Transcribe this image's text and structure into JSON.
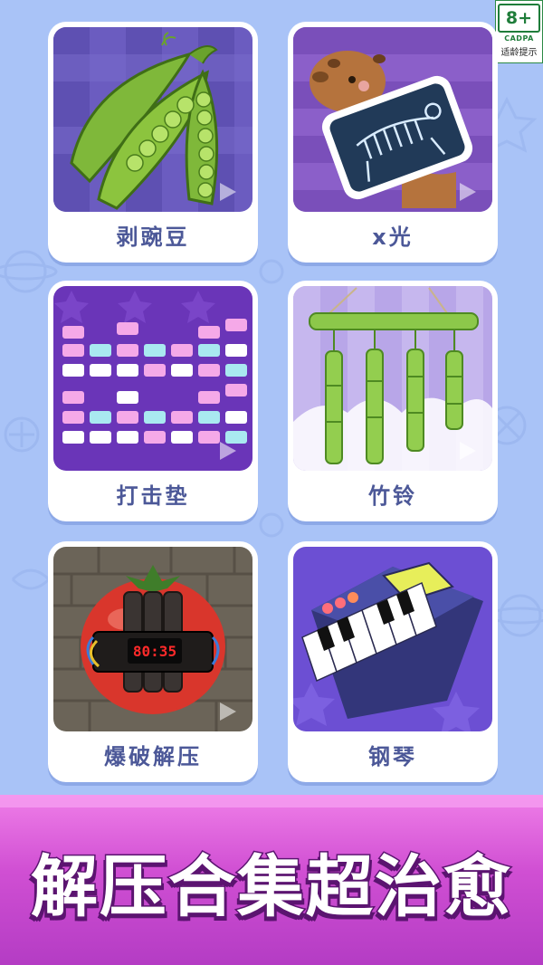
{
  "age_rating": {
    "value": "8+",
    "organization": "CADPA",
    "caption": "适龄提示"
  },
  "games": [
    {
      "label": "剥豌豆",
      "thumbnail_icon": "pea-pods-icon"
    },
    {
      "label": "x光",
      "thumbnail_icon": "capybara-xray-icon"
    },
    {
      "label": "打击垫",
      "thumbnail_icon": "drum-pad-icon"
    },
    {
      "label": "竹铃",
      "thumbnail_icon": "bamboo-chime-icon"
    },
    {
      "label": "爆破解压",
      "thumbnail_icon": "tomato-bomb-icon",
      "timer": "80:35"
    },
    {
      "label": "钢琴",
      "thumbnail_icon": "piano-icon"
    }
  ],
  "banner": {
    "title": "解压合集超治愈"
  },
  "colors": {
    "background": "#a9c3f7",
    "card_label": "#4c5898",
    "banner": "#d04fd3"
  }
}
